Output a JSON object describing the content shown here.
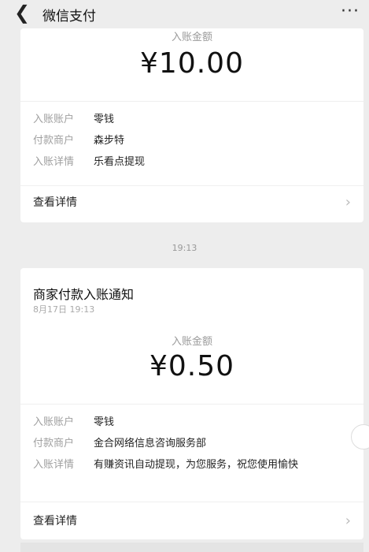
{
  "header": {
    "back_icon": "chevron-left-icon",
    "title": "微信支付",
    "more_icon": "more-icon",
    "more_glyph": "···"
  },
  "card1": {
    "amount_label": "入账金额",
    "amount": "¥10.00",
    "rows": [
      {
        "key": "入账账户",
        "value": "零钱"
      },
      {
        "key": "付款商户",
        "value": "森步特"
      },
      {
        "key": "入账详情",
        "value": "乐看点提现"
      }
    ],
    "detail_label": "查看详情"
  },
  "separator_time": "19:13",
  "card2": {
    "title": "商家付款入账通知",
    "date": "8月17日 19:13",
    "amount_label": "入账金额",
    "amount": "¥0.50",
    "rows": [
      {
        "key": "入账账户",
        "value": "零钱"
      },
      {
        "key": "付款商户",
        "value": "金合网络信息咨询服务部"
      },
      {
        "key": "入账详情",
        "value": "有赚资讯自动提现，为您服务，祝您使用愉快"
      }
    ],
    "detail_label": "查看详情"
  }
}
